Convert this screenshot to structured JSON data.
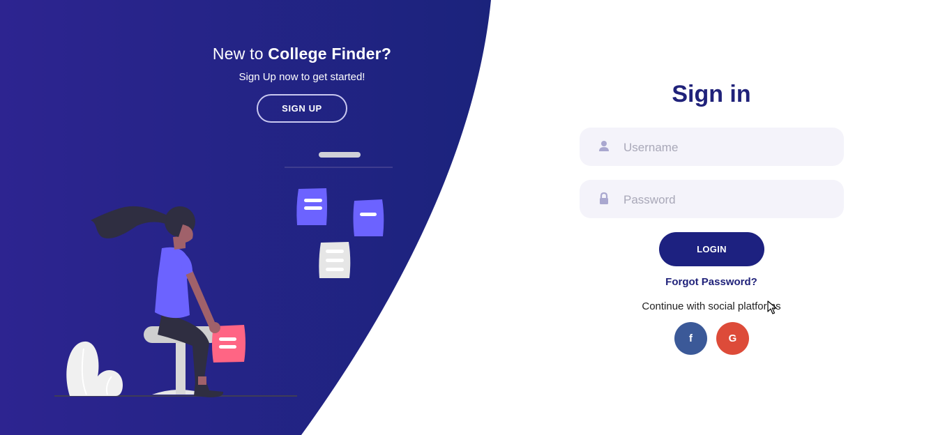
{
  "promo": {
    "title_prefix": "New to ",
    "title_brand": "College Finder?",
    "subtitle": "Sign Up now to get started!",
    "signup_label": "SIGN UP"
  },
  "signin": {
    "title": "Sign in",
    "username_placeholder": "Username",
    "password_placeholder": "Password",
    "login_label": "LOGIN",
    "forgot_label": "Forgot Password?",
    "social_text": "Continue with social platforms",
    "facebook_glyph": "f",
    "google_glyph": "G"
  },
  "icons": {
    "username": "user-icon",
    "password": "lock-icon",
    "facebook": "facebook-icon",
    "google": "google-icon"
  },
  "colors": {
    "panel_start": "#2d2490",
    "panel_end": "#1b237c",
    "brand": "#20227a",
    "login_button": "#1d2180",
    "facebook": "#3b5998",
    "google": "#dd4b39",
    "field_bg": "#f4f3fa",
    "accent_purple": "#6c63ff",
    "accent_pink": "#ff6584"
  }
}
